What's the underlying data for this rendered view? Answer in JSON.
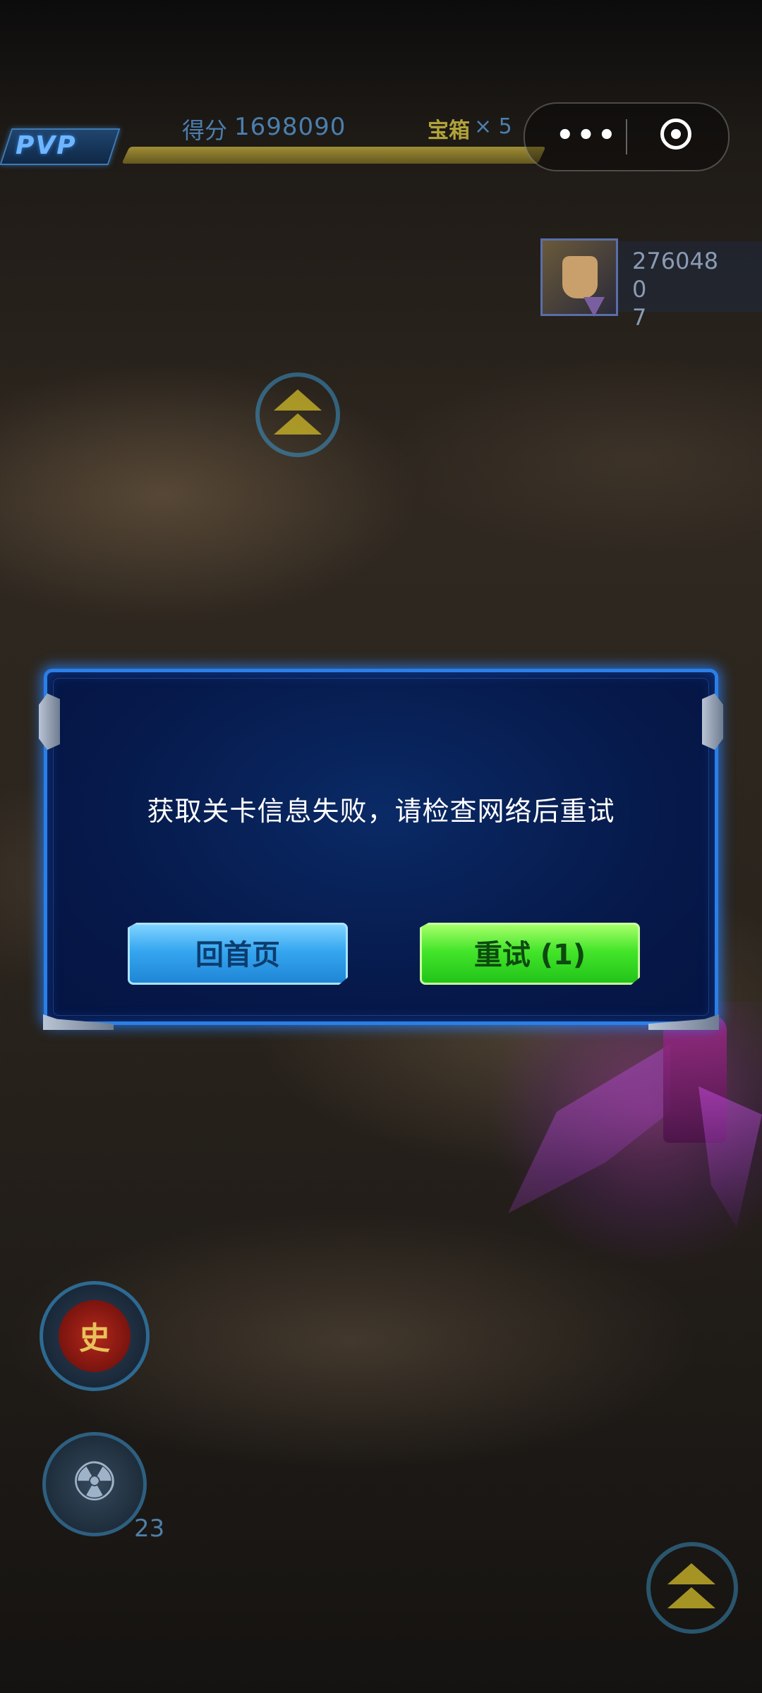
{
  "hud": {
    "mode_badge": "PVP",
    "score_label": "得分",
    "score_value": "1698090",
    "chest_label": "宝箱",
    "chest_count": "× 5"
  },
  "miniprogram_capsule": {
    "more_glyph": "•••",
    "close_icon": "target-circle-icon"
  },
  "opponent": {
    "score_line1": "2760480",
    "score_line2": "7"
  },
  "dialog": {
    "message": "获取关卡信息失败，请检查网络后重试",
    "home_button": "回首页",
    "retry_button": "重试 (1)"
  },
  "skills": {
    "special_glyph": "史",
    "bomb_glyph": "☢",
    "bomb_count": "23"
  },
  "colors": {
    "dialog_border": "#2a7fe8",
    "dialog_bg": "#06194a",
    "home_button": "#36a6f0",
    "retry_button": "#44e52a"
  }
}
